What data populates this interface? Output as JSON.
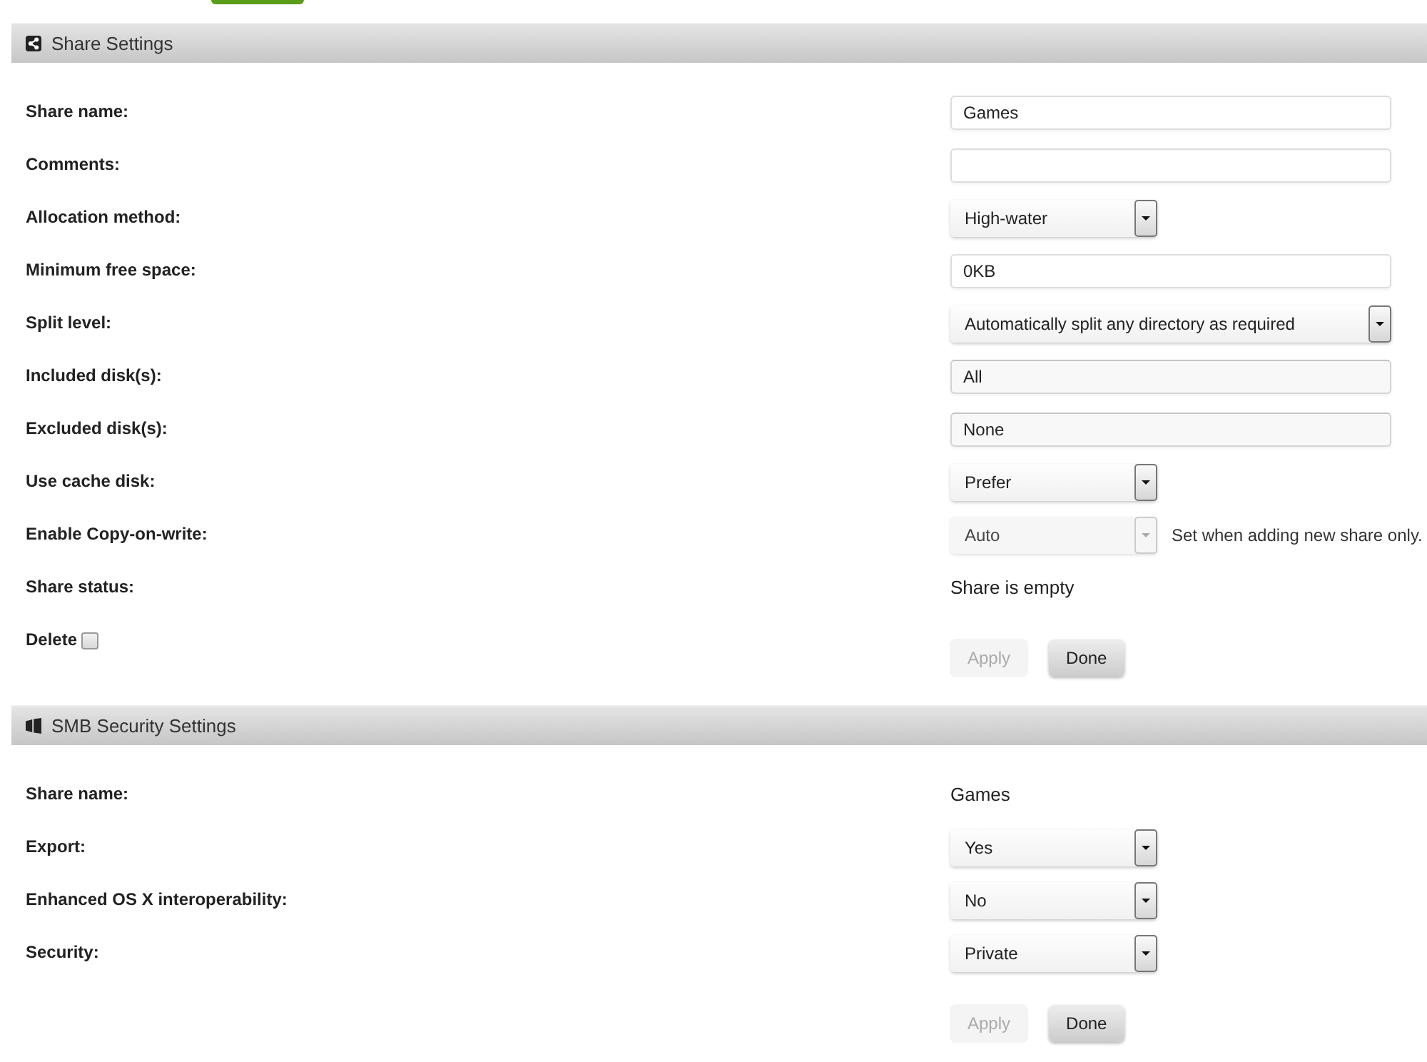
{
  "sections": [
    {
      "title": "Share Settings",
      "rows": [
        {
          "kind": "text",
          "label": "Share name:",
          "value": "Games",
          "disabled": false
        },
        {
          "kind": "text",
          "label": "Comments:",
          "disabled": false
        },
        {
          "kind": "select",
          "label": "Allocation method:",
          "value": "High-water",
          "disabled": false
        },
        {
          "kind": "text",
          "label": "Minimum free space:",
          "value": "0KB",
          "disabled": false
        },
        {
          "kind": "select",
          "label": "Split level:",
          "value": "Automatically split any directory as required",
          "disabled": false
        },
        {
          "kind": "picker",
          "label": "Included disk(s):",
          "value": "All",
          "disabled": false
        },
        {
          "kind": "picker",
          "label": "Excluded disk(s):",
          "value": "None",
          "disabled": false
        },
        {
          "kind": "select",
          "label": "Use cache disk:",
          "value": "Prefer",
          "disabled": false
        },
        {
          "kind": "select",
          "label": "Enable Copy-on-write:",
          "value": "Auto",
          "disabled": true,
          "note": "Set when adding new share only."
        },
        {
          "kind": "static",
          "label": "Share status:",
          "value": "Share is empty",
          "disabled": false
        }
      ],
      "delete": {
        "label": "Delete",
        "checked": false
      },
      "buttons": [
        {
          "label": "Apply",
          "disabled": true
        },
        {
          "label": "Done",
          "disabled": false
        }
      ]
    },
    {
      "title": "SMB Security Settings",
      "rows": [
        {
          "kind": "static",
          "label": "Share name:",
          "value": "Games",
          "disabled": false
        },
        {
          "kind": "select",
          "label": "Export:",
          "value": "Yes",
          "disabled": false
        },
        {
          "kind": "select",
          "label": "Enhanced OS X interoperability:",
          "value": "No",
          "disabled": false
        },
        {
          "kind": "select",
          "label": "Security:",
          "value": "Private",
          "disabled": false
        }
      ],
      "buttons": [
        {
          "label": "Apply",
          "disabled": true
        },
        {
          "label": "Done",
          "disabled": false
        }
      ]
    }
  ]
}
